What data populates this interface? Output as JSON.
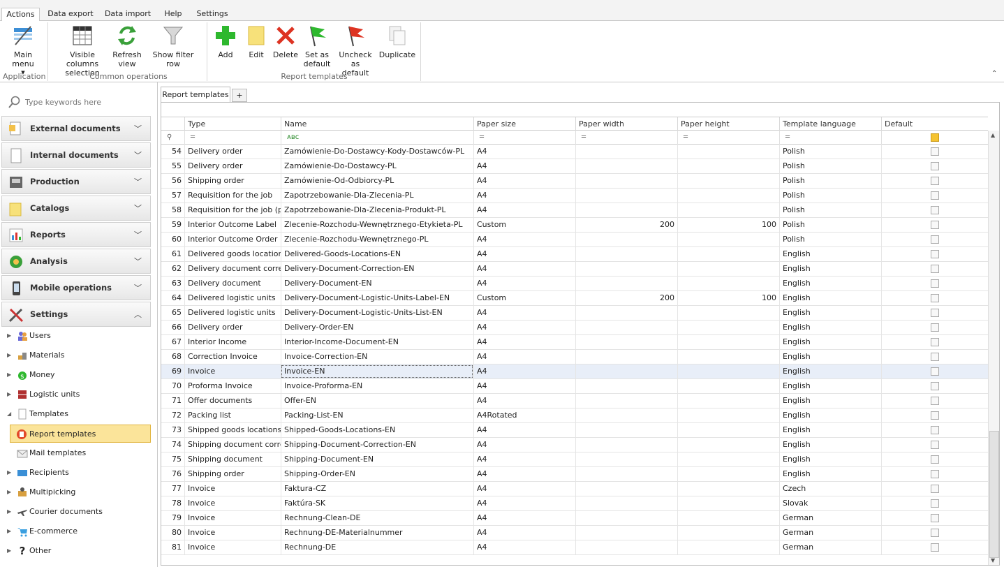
{
  "ribbon": {
    "tabs": [
      "Actions",
      "Data export",
      "Data import",
      "Help",
      "Settings"
    ],
    "groups": {
      "application": "Application",
      "common": "Common operations",
      "templates": "Report templates"
    },
    "buttons": {
      "main_menu": "Main menu",
      "visible_columns": "Visible columns",
      "visible_columns2": "selection",
      "refresh": "Refresh",
      "refresh2": "view",
      "show_filter": "Show filter row",
      "add": "Add",
      "edit": "Edit",
      "delete": "Delete",
      "set_default": "Set as",
      "set_default2": "default",
      "uncheck_default": "Uncheck as",
      "uncheck_default2": "default",
      "duplicate": "Duplicate"
    }
  },
  "sidebar": {
    "search_placeholder": "Type keywords here",
    "sections": [
      "External documents",
      "Internal documents",
      "Production",
      "Catalogs",
      "Reports",
      "Analysis",
      "Mobile operations",
      "Settings"
    ],
    "tree": [
      "Users",
      "Materials",
      "Money",
      "Logistic units",
      "Templates",
      "Report templates",
      "Mail templates",
      "Recipients",
      "Multipicking",
      "Courier documents",
      "E-commerce",
      "Other"
    ]
  },
  "doc_tab": "Report templates",
  "plus": "+",
  "columns": [
    "Type",
    "Name",
    "Paper size",
    "Paper width",
    "Paper height",
    "Template language",
    "Default"
  ],
  "filter_abc": "ᴀʙc",
  "filter_eq": "═",
  "rows": [
    [
      "54",
      "Delivery order",
      "Zamówienie-Do-Dostawcy-Kody-Dostawców-PL",
      "A4",
      "",
      "",
      "Polish"
    ],
    [
      "55",
      "Delivery order",
      "Zamówienie-Do-Dostawcy-PL",
      "A4",
      "",
      "",
      "Polish"
    ],
    [
      "56",
      "Shipping order",
      "Zamówienie-Od-Odbiorcy-PL",
      "A4",
      "",
      "",
      "Polish"
    ],
    [
      "57",
      "Requisition for the job",
      "Zapotrzebowanie-Dla-Zlecenia-PL",
      "A4",
      "",
      "",
      "Polish"
    ],
    [
      "58",
      "Requisition for the job (p...",
      "Zapotrzebowanie-Dla-Zlecenia-Produkt-PL",
      "A4",
      "",
      "",
      "Polish"
    ],
    [
      "59",
      "Interior Outcome Label",
      "Zlecenie-Rozchodu-Wewnętrznego-Etykieta-PL",
      "Custom",
      "200",
      "100",
      "Polish"
    ],
    [
      "60",
      "Interior Outcome Order",
      "Zlecenie-Rozchodu-Wewnętrznego-PL",
      "A4",
      "",
      "",
      "Polish"
    ],
    [
      "61",
      "Delivered goods locations",
      "Delivered-Goods-Locations-EN",
      "A4",
      "",
      "",
      "English"
    ],
    [
      "62",
      "Delivery document corre...",
      "Delivery-Document-Correction-EN",
      "A4",
      "",
      "",
      "English"
    ],
    [
      "63",
      "Delivery document",
      "Delivery-Document-EN",
      "A4",
      "",
      "",
      "English"
    ],
    [
      "64",
      "Delivered logistic units",
      "Delivery-Document-Logistic-Units-Label-EN",
      "Custom",
      "200",
      "100",
      "English"
    ],
    [
      "65",
      "Delivered logistic units",
      "Delivery-Document-Logistic-Units-List-EN",
      "A4",
      "",
      "",
      "English"
    ],
    [
      "66",
      "Delivery order",
      "Delivery-Order-EN",
      "A4",
      "",
      "",
      "English"
    ],
    [
      "67",
      "Interior Income",
      "Interior-Income-Document-EN",
      "A4",
      "",
      "",
      "English"
    ],
    [
      "68",
      "Correction Invoice",
      "Invoice-Correction-EN",
      "A4",
      "",
      "",
      "English"
    ],
    [
      "69",
      "Invoice",
      "Invoice-EN",
      "A4",
      "",
      "",
      "English"
    ],
    [
      "70",
      "Proforma Invoice",
      "Invoice-Proforma-EN",
      "A4",
      "",
      "",
      "English"
    ],
    [
      "71",
      "Offer documents",
      "Offer-EN",
      "A4",
      "",
      "",
      "English"
    ],
    [
      "72",
      "Packing list",
      "Packing-List-EN",
      "A4Rotated",
      "",
      "",
      "English"
    ],
    [
      "73",
      "Shipped goods locations",
      "Shipped-Goods-Locations-EN",
      "A4",
      "",
      "",
      "English"
    ],
    [
      "74",
      "Shipping document corre...",
      "Shipping-Document-Correction-EN",
      "A4",
      "",
      "",
      "English"
    ],
    [
      "75",
      "Shipping document",
      "Shipping-Document-EN",
      "A4",
      "",
      "",
      "English"
    ],
    [
      "76",
      "Shipping order",
      "Shipping-Order-EN",
      "A4",
      "",
      "",
      "English"
    ],
    [
      "77",
      "Invoice",
      "Faktura-CZ",
      "A4",
      "",
      "",
      "Czech"
    ],
    [
      "78",
      "Invoice",
      "Faktúra-SK",
      "A4",
      "",
      "",
      "Slovak"
    ],
    [
      "79",
      "Invoice",
      "Rechnung-Clean-DE",
      "A4",
      "",
      "",
      "German"
    ],
    [
      "80",
      "Invoice",
      "Rechnung-DE-Materialnummer",
      "A4",
      "",
      "",
      "German"
    ],
    [
      "81",
      "Invoice",
      "Rechnung-DE",
      "A4",
      "",
      "",
      "German"
    ]
  ],
  "selected_row": "69",
  "colors": {
    "accent": "#fbe49a",
    "selection": "#e8eef8"
  }
}
